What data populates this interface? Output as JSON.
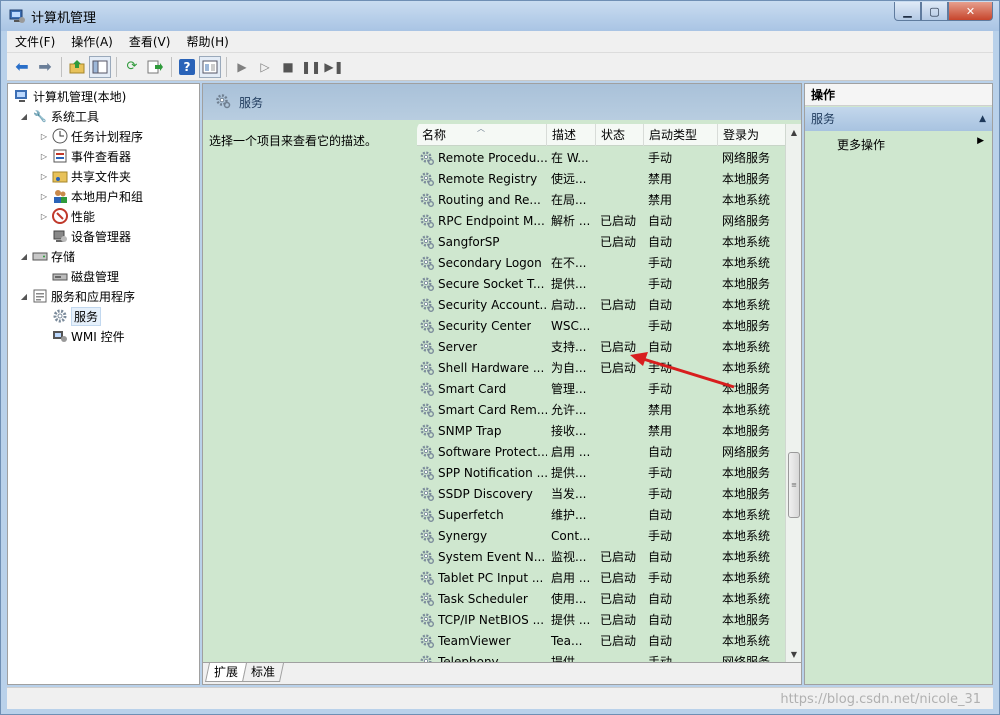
{
  "window": {
    "title": "计算机管理"
  },
  "menu": [
    "文件(F)",
    "操作(A)",
    "查看(V)",
    "帮助(H)"
  ],
  "toolbar": {
    "buttons": [
      "back-icon",
      "forward-icon",
      "up-folder-icon",
      "show-hide-tree-icon",
      "refresh-icon",
      "export-list-icon",
      "help-icon",
      "console-tree-icon",
      "play-icon",
      "play-outline-icon",
      "stop-icon",
      "pause-icon",
      "restart-icon"
    ]
  },
  "tree": {
    "root": "计算机管理(本地)",
    "system_tools": "系统工具",
    "task_scheduler": "任务计划程序",
    "event_viewer": "事件查看器",
    "shared_folders": "共享文件夹",
    "local_users": "本地用户和组",
    "performance": "性能",
    "device_manager": "设备管理器",
    "storage": "存储",
    "disk_management": "磁盘管理",
    "services_apps": "服务和应用程序",
    "services": "服务",
    "wmi": "WMI 控件"
  },
  "center": {
    "header": "服务",
    "description_hint": "选择一个项目来查看它的描述。",
    "columns": [
      "名称",
      "描述",
      "状态",
      "启动类型",
      "登录为"
    ],
    "rows": [
      [
        "Remote Procedu...",
        "在 W...",
        "",
        "手动",
        "网络服务"
      ],
      [
        "Remote Registry",
        "使远...",
        "",
        "禁用",
        "本地服务"
      ],
      [
        "Routing and Re...",
        "在局...",
        "",
        "禁用",
        "本地系统"
      ],
      [
        "RPC Endpoint M...",
        "解析 ...",
        "已启动",
        "自动",
        "网络服务"
      ],
      [
        "SangforSP",
        "",
        "已启动",
        "自动",
        "本地系统"
      ],
      [
        "Secondary Logon",
        "在不...",
        "",
        "手动",
        "本地系统"
      ],
      [
        "Secure Socket T...",
        "提供...",
        "",
        "手动",
        "本地服务"
      ],
      [
        "Security Account...",
        "启动...",
        "已启动",
        "自动",
        "本地系统"
      ],
      [
        "Security Center",
        "WSC...",
        "",
        "手动",
        "本地服务"
      ],
      [
        "Server",
        "支持...",
        "已启动",
        "自动",
        "本地系统"
      ],
      [
        "Shell Hardware ...",
        "为自...",
        "已启动",
        "手动",
        "本地系统"
      ],
      [
        "Smart Card",
        "管理...",
        "",
        "手动",
        "本地服务"
      ],
      [
        "Smart Card Rem...",
        "允许...",
        "",
        "禁用",
        "本地系统"
      ],
      [
        "SNMP Trap",
        "接收...",
        "",
        "禁用",
        "本地服务"
      ],
      [
        "Software Protect...",
        "启用 ...",
        "",
        "自动",
        "网络服务"
      ],
      [
        "SPP Notification ...",
        "提供...",
        "",
        "手动",
        "本地服务"
      ],
      [
        "SSDP Discovery",
        "当发...",
        "",
        "手动",
        "本地服务"
      ],
      [
        "Superfetch",
        "维护...",
        "",
        "自动",
        "本地系统"
      ],
      [
        "Synergy",
        "Cont...",
        "",
        "手动",
        "本地系统"
      ],
      [
        "System Event N...",
        "监视...",
        "已启动",
        "自动",
        "本地系统"
      ],
      [
        "Tablet PC Input ...",
        "启用 ...",
        "已启动",
        "手动",
        "本地系统"
      ],
      [
        "Task Scheduler",
        "使用...",
        "已启动",
        "自动",
        "本地系统"
      ],
      [
        "TCP/IP NetBIOS ...",
        "提供 ...",
        "已启动",
        "自动",
        "本地服务"
      ],
      [
        "TeamViewer",
        "Tea...",
        "已启动",
        "自动",
        "本地系统"
      ],
      [
        "Telephony",
        "提供...",
        "",
        "手动",
        "网络服务"
      ]
    ],
    "tabs": [
      "扩展",
      "标准"
    ]
  },
  "actions": {
    "title": "操作",
    "section": "服务",
    "more": "更多操作"
  },
  "watermark": "https://blog.csdn.net/nicole_31"
}
